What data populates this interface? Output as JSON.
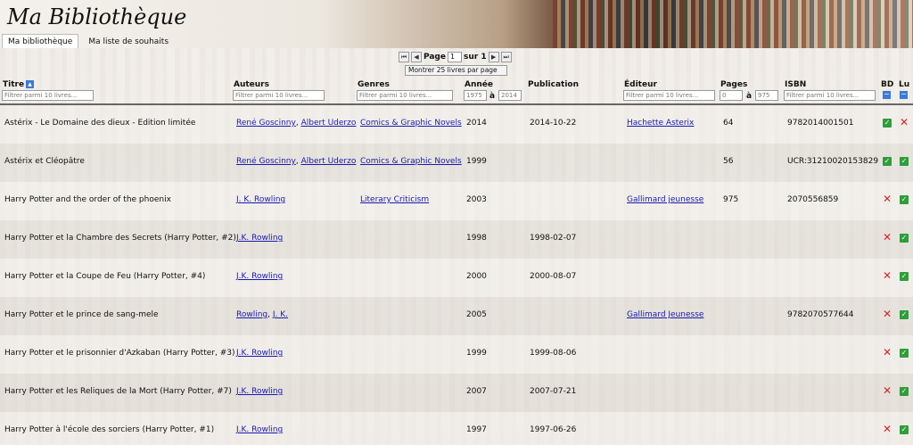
{
  "app": {
    "title": "Ma Bibliothèque"
  },
  "tabs": [
    {
      "label": "Ma bibliothèque"
    },
    {
      "label": "Ma liste de souhaits"
    }
  ],
  "pager": {
    "first": "⏮",
    "prev": "◀",
    "next": "▶",
    "last": "⏭",
    "page_label": "Page",
    "page_value": "1",
    "of_label": "sur 1",
    "per_page": "Montrer 25 livres par page"
  },
  "columns": {
    "title": "Titre",
    "authors": "Auteurs",
    "genres": "Genres",
    "year": "Année",
    "publication": "Publication",
    "publisher": "Éditeur",
    "pages": "Pages",
    "isbn": "ISBN",
    "bd": "BD",
    "lu": "Lu"
  },
  "filters": {
    "placeholder": "Filtrer parmi 10 livres...",
    "year_from": "1975",
    "year_to": "2014",
    "range_sep": "à",
    "pages_from": "0",
    "pages_to": "975"
  },
  "icons": {
    "check": "✓",
    "cross": "✕",
    "sort": "▲",
    "minus": "−"
  },
  "books": [
    {
      "title": "Astérix - Le Domaine des dieux - Edition limitée",
      "authors": [
        "René Goscinny",
        "Albert Uderzo"
      ],
      "genre": "Comics & Graphic Novels",
      "year": "2014",
      "publication": "2014-10-22",
      "publisher": "Hachette Asterix",
      "pages": "64",
      "isbn": "9782014001501",
      "bd": true,
      "lu": false
    },
    {
      "title": "Astérix et Cléopâtre",
      "authors": [
        "René Goscinny",
        "Albert Uderzo"
      ],
      "genre": "Comics & Graphic Novels",
      "year": "1999",
      "publication": "",
      "publisher": "",
      "pages": "56",
      "isbn": "UCR:31210020153829",
      "bd": true,
      "lu": true
    },
    {
      "title": "Harry Potter and the order of the phoenix",
      "authors": [
        "J. K. Rowling"
      ],
      "genre": "Literary Criticism",
      "year": "2003",
      "publication": "",
      "publisher": "Gallimard jeunesse",
      "pages": "975",
      "isbn": "2070556859",
      "bd": false,
      "lu": true
    },
    {
      "title": "Harry Potter et la Chambre des Secrets (Harry Potter, #2)",
      "authors": [
        "J.K. Rowling"
      ],
      "genre": "",
      "year": "1998",
      "publication": "1998-02-07",
      "publisher": "",
      "pages": "",
      "isbn": "",
      "bd": false,
      "lu": true
    },
    {
      "title": "Harry Potter et la Coupe de Feu (Harry Potter, #4)",
      "authors": [
        "J.K. Rowling"
      ],
      "genre": "",
      "year": "2000",
      "publication": "2000-08-07",
      "publisher": "",
      "pages": "",
      "isbn": "",
      "bd": false,
      "lu": true
    },
    {
      "title": "Harry Potter et le prince de sang-mele",
      "authors": [
        "Rowling",
        "J. K."
      ],
      "genre": "",
      "year": "2005",
      "publication": "",
      "publisher": "Gallimard Jeunesse",
      "pages": "",
      "isbn": "9782070577644",
      "bd": false,
      "lu": true
    },
    {
      "title": "Harry Potter et le prisonnier d'Azkaban (Harry Potter, #3)",
      "authors": [
        "J.K. Rowling"
      ],
      "genre": "",
      "year": "1999",
      "publication": "1999-08-06",
      "publisher": "",
      "pages": "",
      "isbn": "",
      "bd": false,
      "lu": true
    },
    {
      "title": "Harry Potter et les Reliques de la Mort (Harry Potter, #7)",
      "authors": [
        "J.K. Rowling"
      ],
      "genre": "",
      "year": "2007",
      "publication": "2007-07-21",
      "publisher": "",
      "pages": "",
      "isbn": "",
      "bd": false,
      "lu": true
    },
    {
      "title": "Harry Potter à l'école des sorciers (Harry Potter, #1)",
      "authors": [
        "J.K. Rowling"
      ],
      "genre": "",
      "year": "1997",
      "publication": "1997-06-26",
      "publisher": "",
      "pages": "",
      "isbn": "",
      "bd": false,
      "lu": true
    }
  ]
}
